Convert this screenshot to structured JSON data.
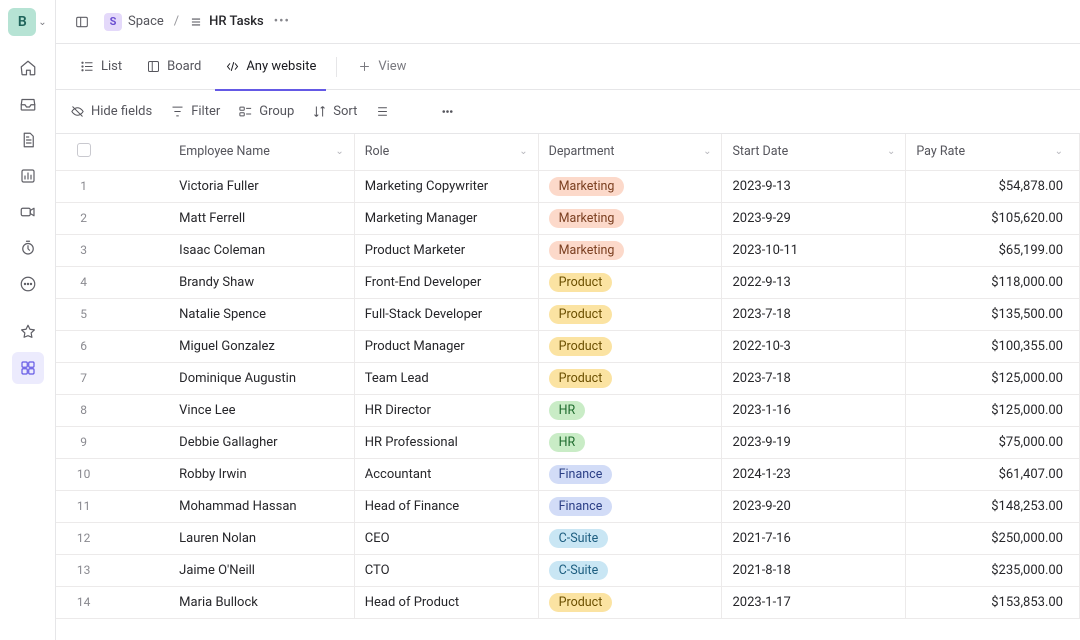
{
  "workspace": {
    "initial": "B"
  },
  "breadcrumb": {
    "space_label": "Space",
    "sep": "/",
    "page_label": "HR Tasks"
  },
  "view_tabs": {
    "list": "List",
    "board": "Board",
    "anysite": "Any website",
    "addview": "View"
  },
  "toolbar": {
    "hide": "Hide fields",
    "filter": "Filter",
    "group": "Group",
    "sort": "Sort"
  },
  "columns": {
    "name": "Employee Name",
    "role": "Role",
    "dept": "Department",
    "date": "Start Date",
    "pay": "Pay Rate"
  },
  "rows": [
    {
      "idx": "1",
      "name": "Victoria Fuller",
      "role": "Marketing Copywriter",
      "dept": "Marketing",
      "date": "2023-9-13",
      "pay": "$54,878.00"
    },
    {
      "idx": "2",
      "name": "Matt Ferrell",
      "role": "Marketing Manager",
      "dept": "Marketing",
      "date": "2023-9-29",
      "pay": "$105,620.00"
    },
    {
      "idx": "3",
      "name": "Isaac Coleman",
      "role": "Product Marketer",
      "dept": "Marketing",
      "date": "2023-10-11",
      "pay": "$65,199.00"
    },
    {
      "idx": "4",
      "name": "Brandy Shaw",
      "role": "Front-End Developer",
      "dept": "Product",
      "date": "2022-9-13",
      "pay": "$118,000.00"
    },
    {
      "idx": "5",
      "name": "Natalie Spence",
      "role": "Full-Stack Developer",
      "dept": "Product",
      "date": "2023-7-18",
      "pay": "$135,500.00"
    },
    {
      "idx": "6",
      "name": "Miguel Gonzalez",
      "role": "Product Manager",
      "dept": "Product",
      "date": "2022-10-3",
      "pay": "$100,355.00"
    },
    {
      "idx": "7",
      "name": "Dominique Augustin",
      "role": "Team Lead",
      "dept": "Product",
      "date": "2023-7-18",
      "pay": "$125,000.00"
    },
    {
      "idx": "8",
      "name": "Vince Lee",
      "role": "HR Director",
      "dept": "HR",
      "date": "2023-1-16",
      "pay": "$125,000.00"
    },
    {
      "idx": "9",
      "name": "Debbie Gallagher",
      "role": "HR Professional",
      "dept": "HR",
      "date": "2023-9-19",
      "pay": "$75,000.00"
    },
    {
      "idx": "10",
      "name": "Robby Irwin",
      "role": "Accountant",
      "dept": "Finance",
      "date": "2024-1-23",
      "pay": "$61,407.00"
    },
    {
      "idx": "11",
      "name": "Mohammad Hassan",
      "role": "Head of Finance",
      "dept": "Finance",
      "date": "2023-9-20",
      "pay": "$148,253.00"
    },
    {
      "idx": "12",
      "name": "Lauren Nolan",
      "role": "CEO",
      "dept": "C-Suite",
      "date": "2021-7-16",
      "pay": "$250,000.00"
    },
    {
      "idx": "13",
      "name": "Jaime O'Neill",
      "role": "CTO",
      "dept": "C-Suite",
      "date": "2021-8-18",
      "pay": "$235,000.00"
    },
    {
      "idx": "14",
      "name": "Maria Bullock",
      "role": "Head of Product",
      "dept": "Product",
      "date": "2023-1-17",
      "pay": "$153,853.00"
    }
  ]
}
